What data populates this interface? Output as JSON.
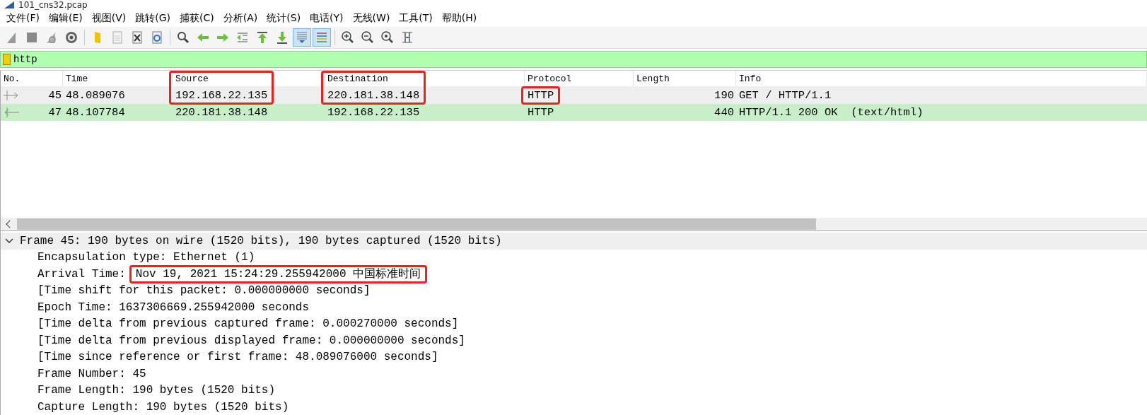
{
  "window": {
    "title": "101_cns32.pcap"
  },
  "menu": [
    {
      "label": "文件(F)"
    },
    {
      "label": "编辑(E)"
    },
    {
      "label": "视图(V)"
    },
    {
      "label": "跳转(G)"
    },
    {
      "label": "捕获(C)"
    },
    {
      "label": "分析(A)"
    },
    {
      "label": "统计(S)"
    },
    {
      "label": "电话(Y)"
    },
    {
      "label": "无线(W)"
    },
    {
      "label": "工具(T)"
    },
    {
      "label": "帮助(H)"
    }
  ],
  "toolbar": [
    {
      "kind": "fin",
      "pressed": false
    },
    {
      "kind": "stop",
      "pressed": false
    },
    {
      "kind": "restart",
      "pressed": false
    },
    {
      "kind": "gear",
      "pressed": false
    },
    {
      "kind": "separator"
    },
    {
      "kind": "folder",
      "pressed": false
    },
    {
      "kind": "document",
      "pressed": false
    },
    {
      "kind": "close-file",
      "pressed": false
    },
    {
      "kind": "reload",
      "pressed": false
    },
    {
      "kind": "separator"
    },
    {
      "kind": "search",
      "pressed": false
    },
    {
      "kind": "left",
      "pressed": false
    },
    {
      "kind": "right",
      "pressed": false
    },
    {
      "kind": "jump",
      "pressed": false
    },
    {
      "kind": "up",
      "pressed": false
    },
    {
      "kind": "down",
      "pressed": false
    },
    {
      "kind": "autoscroll",
      "pressed": true
    },
    {
      "kind": "colorize",
      "pressed": true
    },
    {
      "kind": "separator"
    },
    {
      "kind": "zoom-in",
      "pressed": false
    },
    {
      "kind": "zoom-out",
      "pressed": false
    },
    {
      "kind": "zoom-reset",
      "pressed": false
    },
    {
      "kind": "columns",
      "pressed": false
    }
  ],
  "filter": {
    "value": "http"
  },
  "table": {
    "columns": [
      {
        "label": "No."
      },
      {
        "label": "Time"
      },
      {
        "label": "Source",
        "outlined": true
      },
      {
        "label": "Destination",
        "outlined": true
      },
      {
        "label": "Protocol"
      },
      {
        "label": "Length"
      },
      {
        "label": "Info"
      }
    ],
    "rows": [
      {
        "kind": "request",
        "selected": true,
        "cells": [
          {
            "text": "45"
          },
          {
            "text": "48.089076"
          },
          {
            "text": "192.168.22.135",
            "outlined": true
          },
          {
            "text": "220.181.38.148",
            "outlined": true
          },
          {
            "text": "HTTP",
            "outlined": true
          },
          {
            "text": "190"
          },
          {
            "text": "GET / HTTP/1.1"
          }
        ]
      },
      {
        "kind": "response",
        "selected": false,
        "color": "#c8f0c8",
        "cells": [
          {
            "text": "47"
          },
          {
            "text": "48.107784"
          },
          {
            "text": "220.181.38.148"
          },
          {
            "text": "192.168.22.135"
          },
          {
            "text": "HTTP"
          },
          {
            "text": "440"
          },
          {
            "text": "HTTP/1.1 200 OK  (text/html)"
          }
        ]
      }
    ]
  },
  "details": [
    {
      "text": "Frame 45: 190 bytes on wire (1520 bits), 190 bytes captured (1520 bits)",
      "expanded": true,
      "selected": true,
      "children": [
        {
          "text": "Encapsulation type: Ethernet (1)"
        },
        {
          "label": "Arrival Time:",
          "value": "Nov 19, 2021 15:24:29.255942000 中国标准时间",
          "outlined": true
        },
        {
          "text": "[Time shift for this packet: 0.000000000 seconds]"
        },
        {
          "text": "Epoch Time: 1637306669.255942000 seconds"
        },
        {
          "text": "[Time delta from previous captured frame: 0.000270000 seconds]"
        },
        {
          "text": "[Time delta from previous displayed frame: 0.000000000 seconds]"
        },
        {
          "text": "[Time since reference or first frame: 48.089076000 seconds]"
        },
        {
          "text": "Frame Number: 45"
        },
        {
          "text": "Frame Length: 190 bytes (1520 bits)"
        },
        {
          "text": "Capture Length: 190 bytes (1520 bits)"
        }
      ]
    }
  ]
}
